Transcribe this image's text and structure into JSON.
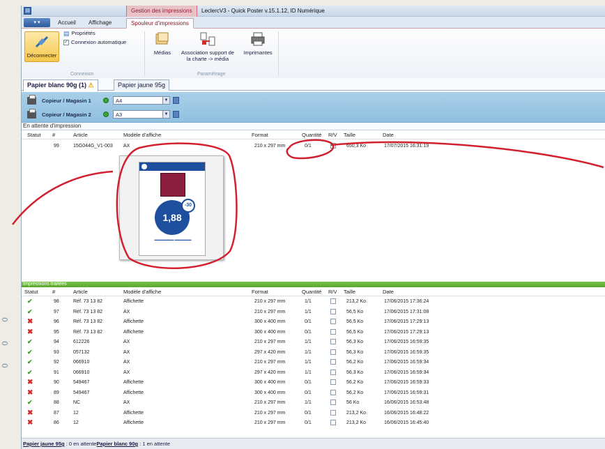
{
  "title_bar": {
    "context_group": "Gestion des impressions",
    "window_title": "LeclercV3 - Quick Poster v.15.1.12, ID Numérique"
  },
  "ribbon_tabs": [
    "Accueil",
    "Affichage",
    "Spouleur d'impressions"
  ],
  "ribbon": {
    "disconnect": "Déconnecter",
    "properties": "Propriétés",
    "auto_connect": "Connexion automatique",
    "group_connexion": "Connexion",
    "medias": "Médias",
    "association_line1": "Association support de",
    "association_line2": "la charte -> média",
    "printers": "Imprimantes",
    "group_parametrage": "Paramétrage"
  },
  "doc_tabs": [
    {
      "label": "Papier blanc 90g (1)",
      "active": true,
      "warning": true
    },
    {
      "label": "Papier jaune 95g",
      "active": false,
      "warning": false
    }
  ],
  "magasins": [
    {
      "label": "Copieur / Magasin 1",
      "format": "A4"
    },
    {
      "label": "Copieur / Magasin 2",
      "format": "A3"
    }
  ],
  "pending": {
    "title": "En attente d'impression",
    "headers": [
      "Statut",
      "#",
      "Article",
      "Modèle d'affiche",
      "Format",
      "Quantité",
      "R/V",
      "Taille",
      "Date"
    ],
    "rows": [
      {
        "num": "99",
        "article": "15G044G_V1-003",
        "modele": "AX",
        "format": "210 x 297 mm",
        "quantite": "0/1",
        "taille": "650,3 Ko",
        "date": "17/07/2015 16:31:19"
      }
    ],
    "preview": {
      "price": "1,88",
      "badge": "-30"
    }
  },
  "processed": {
    "title": "Impressions traitées",
    "headers": [
      "Statut",
      "#",
      "Article",
      "Modèle d'affiche",
      "Format",
      "Quantité",
      "R/V",
      "Taille",
      "Date"
    ],
    "rows": [
      {
        "status": "ok",
        "num": "98",
        "article": "Réf. 73 13 82",
        "modele": "Affichette",
        "format": "210 x 297 mm",
        "quantite": "1/1",
        "taille": "213,2 Ko",
        "date": "17/06/2015 17:36:24"
      },
      {
        "status": "ok",
        "num": "97",
        "article": "Réf. 73 13 82",
        "modele": "AX",
        "format": "210 x 297 mm",
        "quantite": "1/1",
        "taille": "56,5 Ko",
        "date": "17/06/2015 17:31:08"
      },
      {
        "status": "ko",
        "num": "96",
        "article": "Réf. 73 13 82",
        "modele": "Affichette",
        "format": "300 x 400 mm",
        "quantite": "0/1",
        "taille": "56,5 Ko",
        "date": "17/06/2015 17:29:13"
      },
      {
        "status": "ko",
        "num": "95",
        "article": "Réf. 73 13 82",
        "modele": "Affichette",
        "format": "300 x 400 mm",
        "quantite": "0/1",
        "taille": "56,5 Ko",
        "date": "17/06/2015 17:29:13"
      },
      {
        "status": "ok",
        "num": "94",
        "article": "612226",
        "modele": "AX",
        "format": "210 x 297 mm",
        "quantite": "1/1",
        "taille": "56,3 Ko",
        "date": "17/06/2015 16:59:35"
      },
      {
        "status": "ok",
        "num": "93",
        "article": "057132",
        "modele": "AX",
        "format": "297 x 420 mm",
        "quantite": "1/1",
        "taille": "56,3 Ko",
        "date": "17/06/2015 16:59:35"
      },
      {
        "status": "ok",
        "num": "92",
        "article": "066910",
        "modele": "AX",
        "format": "210 x 297 mm",
        "quantite": "1/1",
        "taille": "56,2 Ko",
        "date": "17/06/2015 16:59:34"
      },
      {
        "status": "ok",
        "num": "91",
        "article": "066910",
        "modele": "AX",
        "format": "297 x 420 mm",
        "quantite": "1/1",
        "taille": "56,3 Ko",
        "date": "17/06/2015 16:59:34"
      },
      {
        "status": "ko",
        "num": "90",
        "article": "549467",
        "modele": "Affichette",
        "format": "300 x 400 mm",
        "quantite": "0/1",
        "taille": "56,2 Ko",
        "date": "17/06/2015 16:59:33"
      },
      {
        "status": "ko",
        "num": "89",
        "article": "549467",
        "modele": "Affichette",
        "format": "300 x 400 mm",
        "quantite": "0/1",
        "taille": "56,2 Ko",
        "date": "17/06/2015 16:59:31"
      },
      {
        "status": "ok",
        "num": "88",
        "article": "NC",
        "modele": "AX",
        "format": "210 x 297 mm",
        "quantite": "1/1",
        "taille": "56 Ko",
        "date": "16/06/2015 16:53:48"
      },
      {
        "status": "ko",
        "num": "87",
        "article": "12",
        "modele": "Affichette",
        "format": "210 x 297 mm",
        "quantite": "0/1",
        "taille": "213,2 Ko",
        "date": "16/06/2015 16:48:22"
      },
      {
        "status": "ko",
        "num": "86",
        "article": "12",
        "modele": "Affichette",
        "format": "210 x 297 mm",
        "quantite": "0/1",
        "taille": "213,2 Ko",
        "date": "16/06/2015 16:45:40"
      }
    ]
  },
  "status_bar": {
    "jaune_label": "Papier jaune 95g",
    "jaune_text": " : 0 en attente",
    "blanc_label": "Papier blanc 90g",
    "blanc_text": " : 1 en attente"
  },
  "colors": {
    "accent_red": "#d2202f",
    "ok_green": "#3e9a2e",
    "ko_red": "#d32a2a",
    "ribbon_context": "#e9c2c8"
  },
  "margin_marks": [
    "0",
    "0",
    "0"
  ]
}
